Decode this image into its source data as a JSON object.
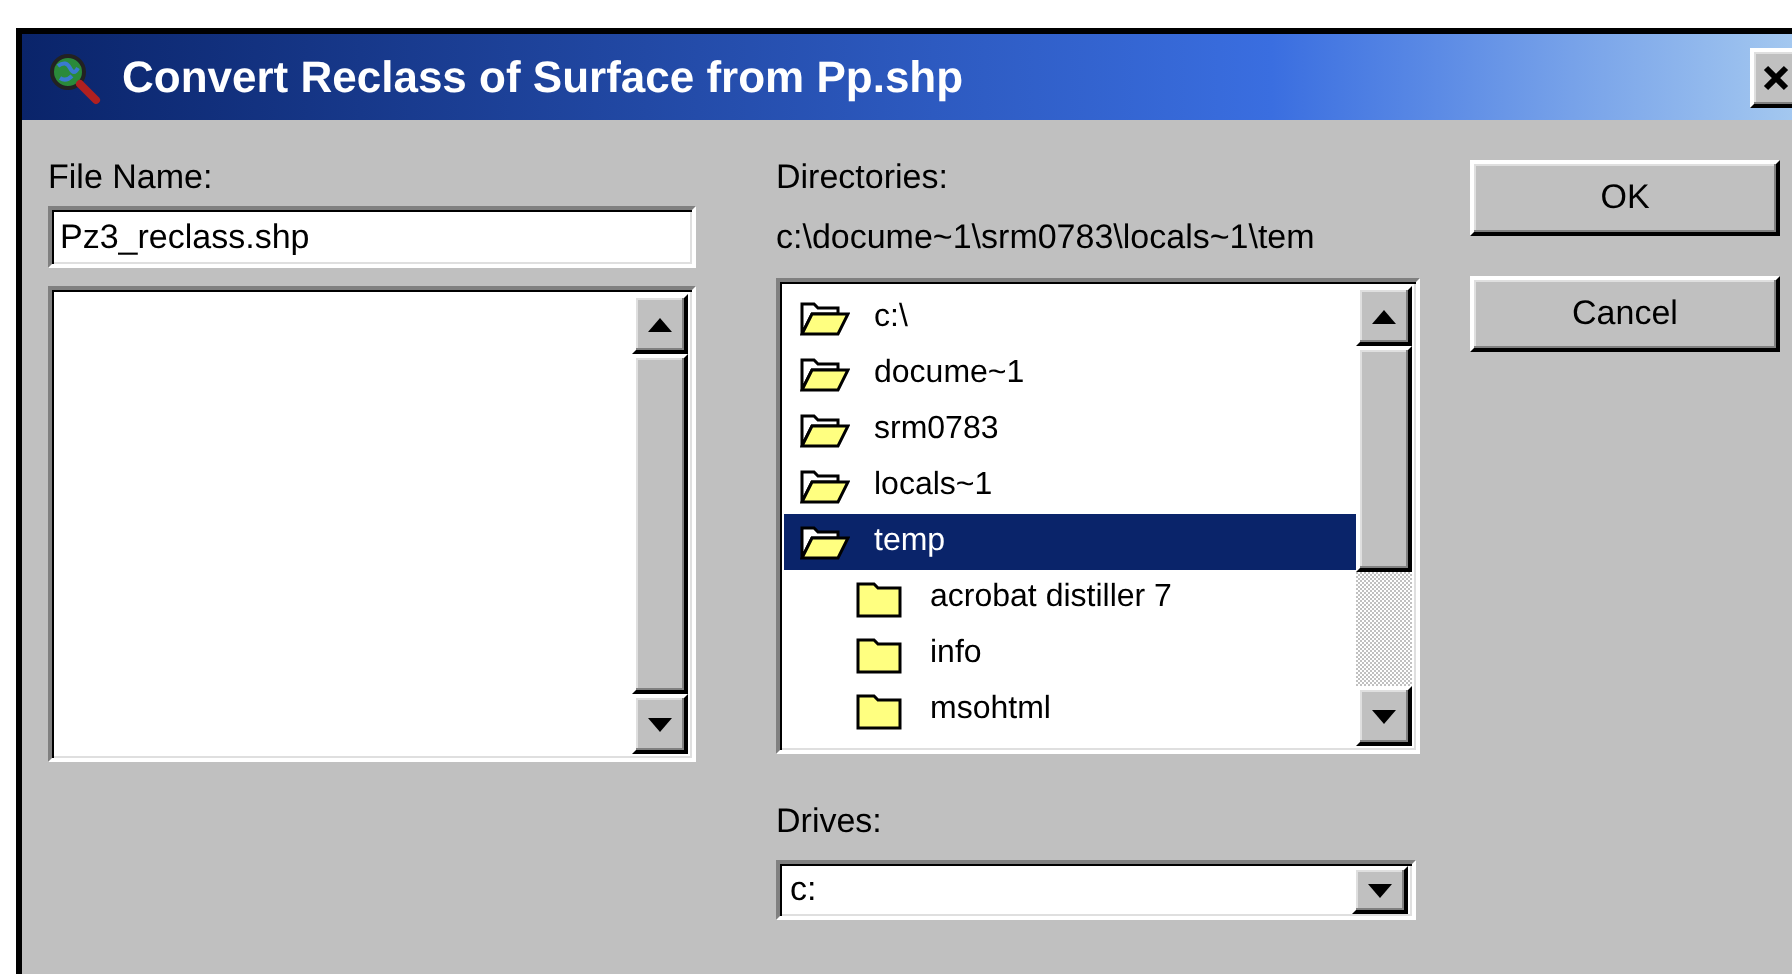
{
  "window": {
    "title": "Convert Reclass of Surface from Pp.shp"
  },
  "file_name": {
    "label": "File Name:",
    "value": "Pz3_reclass.shp"
  },
  "directories": {
    "label": "Directories:",
    "path": "c:\\docume~1\\srm0783\\locals~1\\tem",
    "items": [
      {
        "label": "c:\\",
        "selected": false
      },
      {
        "label": "docume~1",
        "selected": false
      },
      {
        "label": "srm0783",
        "selected": false
      },
      {
        "label": "locals~1",
        "selected": false
      },
      {
        "label": "temp",
        "selected": true,
        "children": [
          {
            "label": "acrobat distiller 7",
            "selected": false
          },
          {
            "label": "info",
            "selected": false
          },
          {
            "label": "msohtml",
            "selected": false
          }
        ]
      }
    ]
  },
  "drives": {
    "label": "Drives:",
    "value": "c:"
  },
  "buttons": [
    "OK",
    "Cancel"
  ]
}
